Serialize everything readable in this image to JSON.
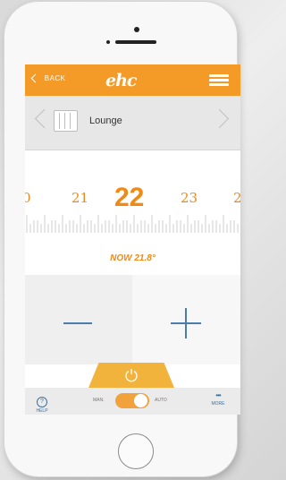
{
  "header": {
    "back_label": "BACK",
    "logo_text": "ehc",
    "brand_color": "#f49a27",
    "menu_icon": "hamburger-menu-icon"
  },
  "room": {
    "name": "Lounge",
    "icon": "radiator-icon",
    "prev_icon": "chevron-left-icon",
    "next_icon": "chevron-right-icon"
  },
  "temperature": {
    "scale": [
      "0",
      "21",
      "22",
      "23",
      "2"
    ],
    "selected": "22",
    "current_label": "NOW 21.8°"
  },
  "controls": {
    "decrease_icon": "minus-icon",
    "increase_icon": "plus-icon",
    "power_icon": "power-icon"
  },
  "bottombar": {
    "help_label": "HELP",
    "help_icon_glyph": "?",
    "mode_left": "MAN.",
    "mode_right": "AUTO",
    "mode_selected": "AUTO",
    "more_label": "MORE"
  }
}
